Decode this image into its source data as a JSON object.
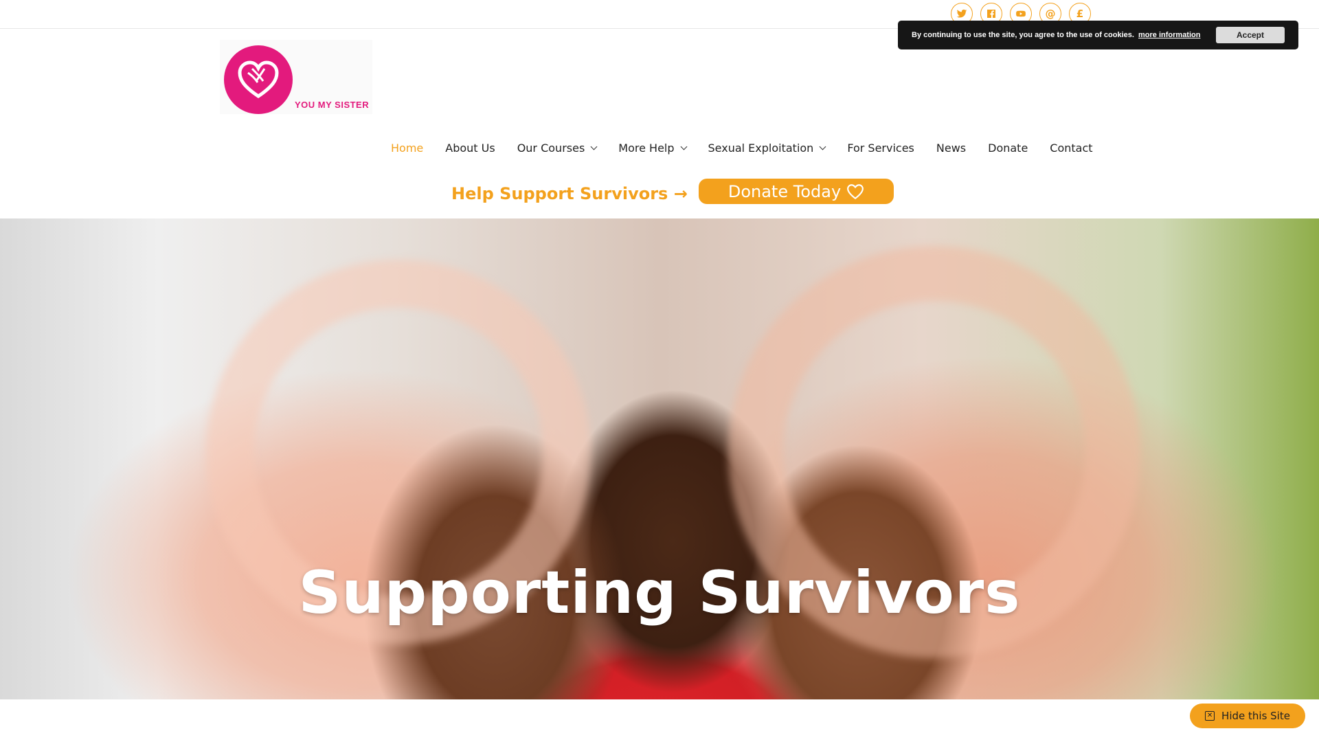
{
  "social": {
    "icons": [
      "twitter-icon",
      "facebook-icon",
      "youtube-icon",
      "email-at-icon",
      "pound-icon"
    ],
    "at_glyph": "@",
    "pound_glyph": "£"
  },
  "cookie": {
    "text": "By continuing to use the site, you agree to the use of cookies.",
    "more_link": "more information",
    "accept_label": "Accept"
  },
  "logo": {
    "brand_text": "YOU MY SISTER"
  },
  "nav": {
    "items": [
      {
        "label": "Home",
        "active": true,
        "dropdown": false
      },
      {
        "label": "About Us",
        "active": false,
        "dropdown": false
      },
      {
        "label": "Our Courses",
        "active": false,
        "dropdown": true
      },
      {
        "label": "More Help",
        "active": false,
        "dropdown": true
      },
      {
        "label": "Sexual Exploitation",
        "active": false,
        "dropdown": true
      },
      {
        "label": "For Services",
        "active": false,
        "dropdown": false
      },
      {
        "label": "News",
        "active": false,
        "dropdown": false
      },
      {
        "label": "Donate",
        "active": false,
        "dropdown": false
      },
      {
        "label": "Contact",
        "active": false,
        "dropdown": false
      }
    ]
  },
  "cta": {
    "support_text": "Help Support Survivors →",
    "donate_label": "Donate Today"
  },
  "hero": {
    "title": "Supporting Survivors"
  },
  "hide_site": {
    "label": "Hide this Site"
  },
  "colors": {
    "accent": "#f3a11d",
    "brand_pink": "#e31a7d",
    "cookie_bg": "#161616"
  }
}
